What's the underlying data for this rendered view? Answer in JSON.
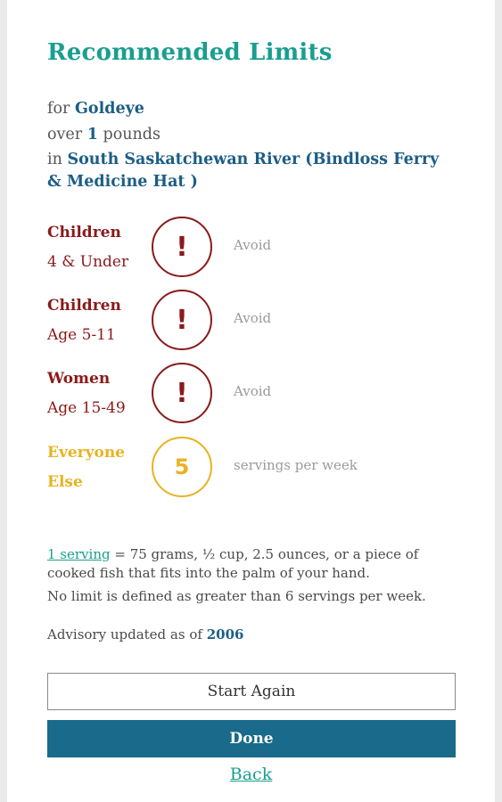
{
  "title": "Recommended Limits",
  "query": {
    "for_prefix": "for",
    "species": "Goldeye",
    "over_prefix": "over",
    "size": "1",
    "size_unit": "pounds",
    "in_prefix": "in",
    "location": "South Saskatchewan River (Bindloss Ferry & Medicine Hat )"
  },
  "groups": [
    {
      "label_top": "Children",
      "label_bottom": "4 & Under",
      "badge": "!",
      "advice": "Avoid"
    },
    {
      "label_top": "Children",
      "label_bottom": "Age 5-11",
      "badge": "!",
      "advice": "Avoid"
    },
    {
      "label_top": "Women",
      "label_bottom": "Age 15-49",
      "badge": "!",
      "advice": "Avoid"
    },
    {
      "label_top": "Everyone",
      "label_bottom": "Else",
      "badge": "5",
      "advice": "servings per week"
    }
  ],
  "notes": {
    "serving_link": "1 serving",
    "serving_text": " = 75 grams, ½ cup, 2.5 ounces, or a piece of cooked fish that fits into the palm of your hand.",
    "no_limit": "No limit is defined as greater than 6 servings per week.",
    "updated_prefix": "Advisory updated as of",
    "updated_year": "2006"
  },
  "buttons": {
    "start_again": "Start Again",
    "done": "Done",
    "back": "Back"
  },
  "colors": {
    "title": "#1a9e8f",
    "highlight": "#1b5e86",
    "avoid": "#8b1a1a",
    "servings": "#e8b321",
    "done_button": "#196a8b"
  }
}
